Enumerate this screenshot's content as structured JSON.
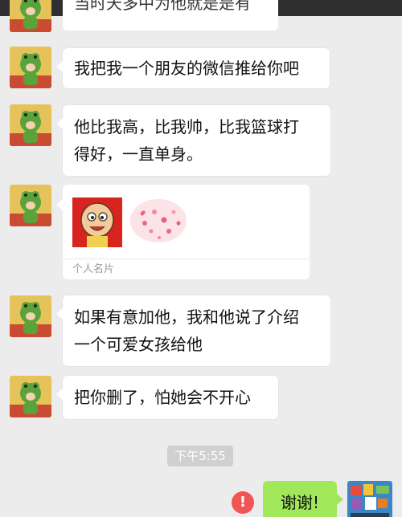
{
  "chat": {
    "partial_message": "当时天多中为他就是是有",
    "messages": [
      {
        "text": "我把我一个朋友的微信推给你吧"
      },
      {
        "line1": "他比我高，比我帅，比我篮球打",
        "line2": "得好，一直单身。"
      },
      {
        "line1": "如果有意加他，我和他说了介绍",
        "line2": "一个可爱女孩给他"
      },
      {
        "text": "把你删了，怕她会不开心"
      }
    ],
    "card_label": "个人名片",
    "timestamp": "下午5:55",
    "sent_message": "谢谢!",
    "error_symbol": "!"
  },
  "colors": {
    "background": "#ececec",
    "sent_bubble": "#a0e75a",
    "error": "#f25353",
    "frog_green": "#5aa33a"
  },
  "icons": {
    "contact_avatar": "frog-costume-avatar",
    "card_avatar": "cartoon-old-man-avatar",
    "card_decoration": "hearts-icon",
    "error": "exclamation-icon",
    "self_avatar": "colorful-photo-avatar"
  }
}
